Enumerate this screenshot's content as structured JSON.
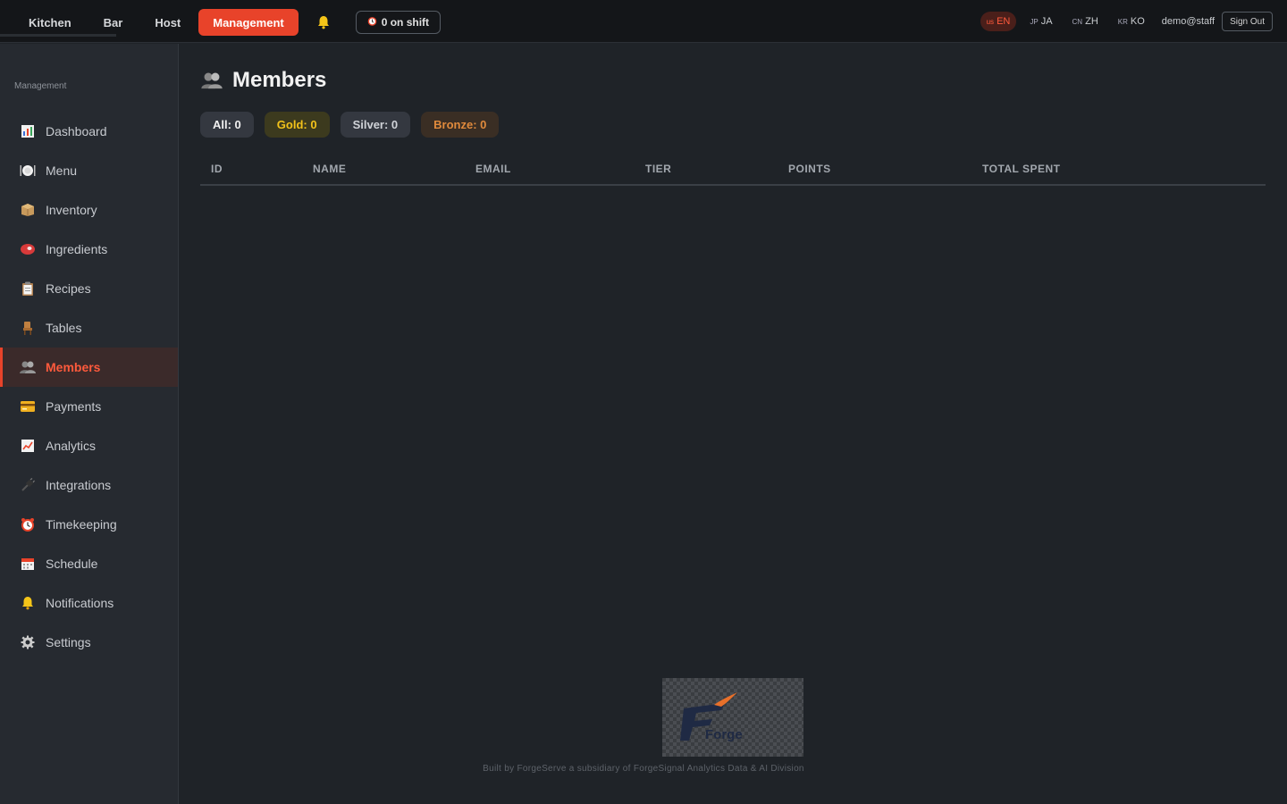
{
  "topnav": {
    "tabs": [
      {
        "label": "Kitchen"
      },
      {
        "label": "Bar"
      },
      {
        "label": "Host"
      },
      {
        "label": "Management",
        "active": true
      }
    ],
    "shift_label": "0 on shift",
    "languages": [
      {
        "code": "us",
        "label": "EN",
        "active": true
      },
      {
        "code": "JP",
        "label": "JA"
      },
      {
        "code": "CN",
        "label": "ZH"
      },
      {
        "code": "KR",
        "label": "KO"
      }
    ],
    "user": "demo@staff",
    "signout_label": "Sign Out"
  },
  "sidebar": {
    "heading": "Management",
    "items": [
      {
        "label": "Dashboard",
        "icon": "bar-chart-icon"
      },
      {
        "label": "Menu",
        "icon": "plate-icon"
      },
      {
        "label": "Inventory",
        "icon": "box-icon"
      },
      {
        "label": "Ingredients",
        "icon": "meat-icon"
      },
      {
        "label": "Recipes",
        "icon": "clipboard-icon"
      },
      {
        "label": "Tables",
        "icon": "chair-icon"
      },
      {
        "label": "Members",
        "icon": "people-icon",
        "active": true
      },
      {
        "label": "Payments",
        "icon": "credit-card-icon"
      },
      {
        "label": "Analytics",
        "icon": "trend-icon"
      },
      {
        "label": "Integrations",
        "icon": "plug-icon"
      },
      {
        "label": "Timekeeping",
        "icon": "alarm-clock-icon"
      },
      {
        "label": "Schedule",
        "icon": "calendar-icon"
      },
      {
        "label": "Notifications",
        "icon": "bell-icon"
      },
      {
        "label": "Settings",
        "icon": "gear-icon"
      }
    ]
  },
  "main": {
    "title": "Members",
    "filters": {
      "all": "All: 0",
      "gold": "Gold: 0",
      "silver": "Silver: 0",
      "bronze": "Bronze: 0"
    },
    "columns": [
      "ID",
      "NAME",
      "EMAIL",
      "TIER",
      "POINTS",
      "TOTAL SPENT"
    ],
    "rows": []
  },
  "footer": {
    "logo_text": "Forge",
    "text": "Built by ForgeServe a subsidiary of ForgeSignal Analytics Data & AI Division"
  },
  "colors": {
    "accent": "#e8432a",
    "gold": "#f2c21a",
    "bronze": "#e08a3c"
  }
}
